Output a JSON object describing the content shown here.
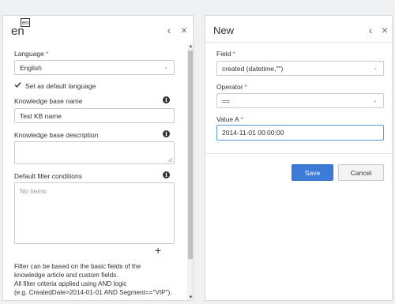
{
  "left_panel": {
    "title": "en",
    "badge": "en",
    "language": {
      "label": "Language",
      "required": "*",
      "value": "English"
    },
    "default_language": {
      "label": "Set as default language",
      "checked": true
    },
    "kb_name": {
      "label": "Knowledge base name",
      "value": "Test KB name"
    },
    "kb_description": {
      "label": "Knowledge base description",
      "value": ""
    },
    "filter": {
      "label": "Default filter conditions",
      "empty_text": "No items",
      "add_symbol": "+"
    },
    "help_lines": [
      "Filter can be based on the basic fields of the",
      "knowledge article and custom fields.",
      "All filter criteria applied using AND logic",
      "(e.g. CreatedDate>2014-01-01 AND Segment==\"VIP\")."
    ]
  },
  "right_panel": {
    "title": "New",
    "field": {
      "label": "Field",
      "required": "*",
      "value": "created (datetime,\"\")"
    },
    "operator": {
      "label": "Operator",
      "required": "*",
      "value": "=="
    },
    "value_a": {
      "label": "Value A",
      "required": "*",
      "value": "2014-11-01 00:00:00"
    },
    "save_label": "Save",
    "cancel_label": "Cancel"
  },
  "icons": {
    "back": "chevron-left-icon",
    "close": "close-icon",
    "info": "info-icon",
    "dropdown": "chevron-down-icon",
    "check": "checkmark-icon",
    "resize": "resize-grip-icon"
  },
  "colors": {
    "accent": "#3d7bd9",
    "required": "#d9534f",
    "focus_border": "#5b9bd5"
  }
}
